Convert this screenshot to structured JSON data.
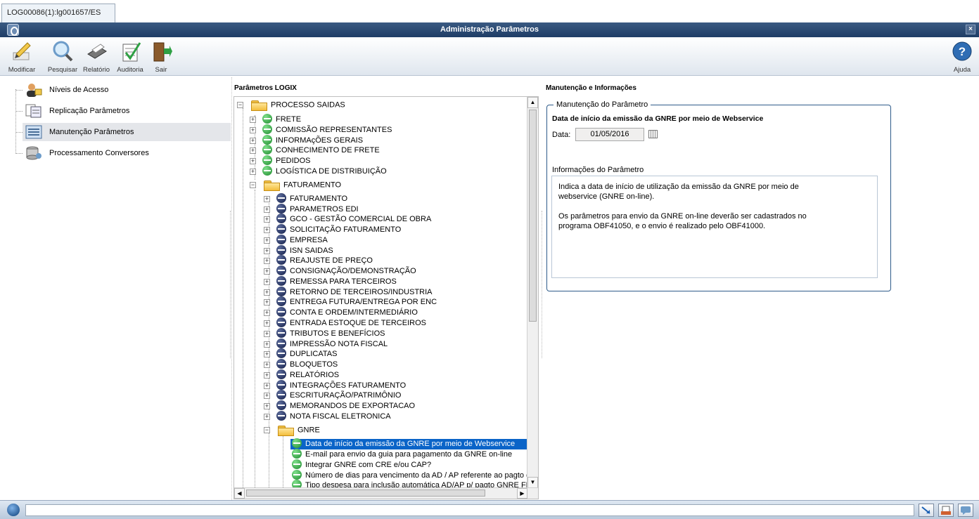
{
  "tab": {
    "label": "LOG00086(1):lg001657/ES"
  },
  "window": {
    "title": "Administração Parâmetros",
    "close": "×"
  },
  "toolbar": {
    "modificar": "Modificar",
    "pesquisar": "Pesquisar",
    "relatorio": "Relatório",
    "auditoria": "Auditoria",
    "sair": "Sair",
    "ajuda": "Ajuda"
  },
  "nav": {
    "items": [
      {
        "label": "Níveis de Acesso",
        "icon": "user-lock-icon"
      },
      {
        "label": "Replicação Parâmetros",
        "icon": "replication-icon"
      },
      {
        "label": "Manutenção Parâmetros",
        "icon": "maintenance-icon",
        "selected": true
      },
      {
        "label": "Processamento Conversores",
        "icon": "database-icon"
      }
    ]
  },
  "tree": {
    "title": "Parâmetros LOGIX",
    "root": "PROCESSO SAIDAS",
    "level1": [
      "FRETE",
      "COMISSÃO REPRESENTANTES",
      "INFORMAçÕES GERAIS",
      "CONHECIMENTO DE FRETE",
      "PEDIDOS",
      "LOGÍSTICA DE DISTRIBUIÇÃO"
    ],
    "faturamento": "FATURAMENTO",
    "level2": [
      "FATURAMENTO",
      "PARAMETROS EDI",
      "GCO - GESTÃO COMERCIAL DE OBRA",
      "SOLICITAÇÃO FATURAMENTO",
      "EMPRESA",
      "ISN SAIDAS",
      "REAJUSTE DE PREÇO",
      "CONSIGNAÇÃO/DEMONSTRAÇÃO",
      "REMESSA PARA TERCEIROS",
      "RETORNO DE TERCEIROS/INDUSTRIA",
      "ENTREGA FUTURA/ENTREGA POR ENC",
      "CONTA E ORDEM/INTERMEDIÁRIO",
      "ENTRADA ESTOQUE DE TERCEIROS",
      "TRIBUTOS E BENEFÍCIOS",
      "IMPRESSÃO NOTA FISCAL",
      "DUPLICATAS",
      "BLOQUETOS",
      "RELATÓRIOS",
      "INTEGRAÇÕES FATURAMENTO",
      "ESCRITURAÇÃO/PATRIMÔNIO",
      "MEMORANDOS DE EXPORTACAO",
      "NOTA FISCAL ELETRONICA"
    ],
    "gnre": "GNRE",
    "gnre_items": [
      {
        "label": "Data de início da emissão da GNRE por meio de Webservice",
        "selected": true
      },
      {
        "label": "E-mail para envio da guia para pagamento da GNRE on-line"
      },
      {
        "label": "Integrar GNRE com CRE e/ou CAP?"
      },
      {
        "label": "Número de dias para vencimento da AD / AP referente ao pagto da"
      },
      {
        "label": "Tipo despesa para inclusão automática AD/AP p/ pagto GNRE FECO"
      }
    ]
  },
  "detail": {
    "section_title": "Manutenção e Informações",
    "group_legend": "Manutenção do Parâmetro",
    "param_title": "Data de início da emissão da GNRE por meio de Webservice",
    "date_label": "Data:",
    "date_value": "01/05/2016",
    "info_label": "Informações do Parâmetro",
    "info_line1": "Indica a data de início de utilização da emissão da GNRE por meio de",
    "info_line2": "webservice (GNRE on-line).",
    "info_line3": "Os parâmetros para envio da GNRE on-line deverão ser cadastrados no",
    "info_line4": "programa OBF41050, e o envio é realizado pelo OBF41000."
  },
  "colors": {
    "title_bar": "#1f3d66",
    "selection": "#0a64c8",
    "group_border": "#2e5b8a"
  }
}
